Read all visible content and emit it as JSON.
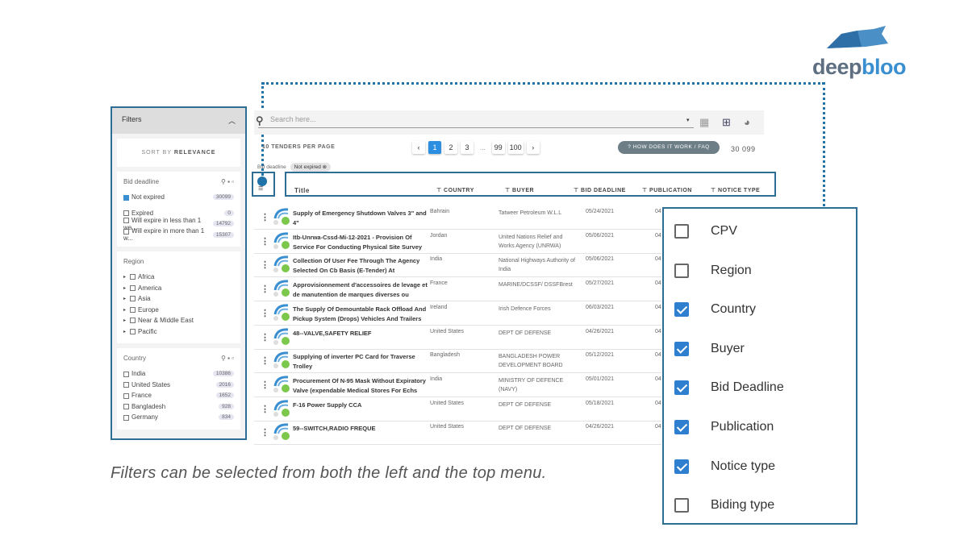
{
  "logo": {
    "text_a": "deep",
    "text_b": "bloo"
  },
  "filters": {
    "title": "Filters",
    "sort_prefix": "SORT BY",
    "sort_value": "RELEVANCE",
    "bid_deadline": {
      "title": "Bid deadline",
      "options": [
        {
          "label": "Not expired",
          "count": "30099",
          "checked": true
        },
        {
          "label": "Expired",
          "count": "0"
        },
        {
          "label": "Will expire in less than 1 we...",
          "count": "14792"
        },
        {
          "label": "Will expire in more than 1 w...",
          "count": "15307"
        }
      ]
    },
    "region": {
      "title": "Region",
      "options": [
        "Africa",
        "America",
        "Asia",
        "Europe",
        "Near & Middle East",
        "Pacific"
      ]
    },
    "country": {
      "title": "Country",
      "options": [
        {
          "label": "India",
          "count": "10386"
        },
        {
          "label": "United States",
          "count": "2016"
        },
        {
          "label": "France",
          "count": "1652"
        },
        {
          "label": "Bangladesh",
          "count": "928"
        },
        {
          "label": "Germany",
          "count": "834"
        }
      ]
    }
  },
  "search": {
    "placeholder": "Search here..."
  },
  "per_page": "10 TENDERS PER PAGE",
  "pages": [
    "1",
    "2",
    "3",
    "...",
    "99",
    "100"
  ],
  "faq": "HOW DOES IT WORK / FAQ",
  "total": "30 099",
  "chip": {
    "label": "Bid deadline",
    "value": "Not expired"
  },
  "columns": [
    "Title",
    "COUNTRY",
    "BUYER",
    "BID DEADLINE",
    "PUBLICATION",
    "NOTICE TYPE"
  ],
  "rows": [
    {
      "title": "Supply of Emergency Shutdown Valves 3\" and 4\"",
      "country": "Bahrain",
      "buyer": "Tatweer Petroleum W.L.L",
      "deadline": "05/24/2021",
      "pub": "04"
    },
    {
      "title": "Itb-Unrwa-Cssd-Mi-12-2021 - Provision Of Service For Conducting Physical Site Survey",
      "country": "Jordan",
      "buyer": "United Nations Relief and Works Agency (UNRWA)",
      "deadline": "05/06/2021",
      "pub": "04"
    },
    {
      "title": "Collection Of User Fee Through The Agency Selected On Cb Basis (E-Tender) At",
      "country": "India",
      "buyer": "National Highways Authority of India",
      "deadline": "05/06/2021",
      "pub": "04"
    },
    {
      "title": "Approvisionnement d'accessoires de levage et de manutention de marques diverses ou",
      "country": "France",
      "buyer": "MARINE/DCSSF/ DSSFBrest",
      "deadline": "05/27/2021",
      "pub": "04"
    },
    {
      "title": "The Supply Of Demountable Rack Offload And Pickup System (Drops) Vehicles And Trailers",
      "country": "Ireland",
      "buyer": "Irish Defence Forces",
      "deadline": "06/03/2021",
      "pub": "04"
    },
    {
      "title": "48--VALVE,SAFETY RELIEF",
      "country": "United States",
      "buyer": "DEPT OF DEFENSE",
      "deadline": "04/26/2021",
      "pub": "04"
    },
    {
      "title": "Supplying of inverter PC Card for Traverse Trolley",
      "country": "Bangladesh",
      "buyer": "BANGLADESH POWER DEVELOPMENT BOARD",
      "deadline": "05/12/2021",
      "pub": "04"
    },
    {
      "title": "Procurement Of N-95 Mask Without Expiratory Valve (expendable Medical Stores For Echs",
      "country": "India",
      "buyer": "MINISTRY OF DEFENCE (NAVY)",
      "deadline": "05/01/2021",
      "pub": "04"
    },
    {
      "title": "F-16 Power Supply CCA",
      "country": "United States",
      "buyer": "DEPT OF DEFENSE",
      "deadline": "05/18/2021",
      "pub": "04"
    },
    {
      "title": "59--SWITCH,RADIO FREQUE",
      "country": "United States",
      "buyer": "DEPT OF DEFENSE",
      "deadline": "04/26/2021",
      "pub": "04"
    }
  ],
  "column_menu": [
    {
      "label": "CPV",
      "checked": false
    },
    {
      "label": "Region",
      "checked": false
    },
    {
      "label": "Country",
      "checked": true
    },
    {
      "label": "Buyer",
      "checked": true
    },
    {
      "label": "Bid Deadline",
      "checked": true
    },
    {
      "label": "Publication",
      "checked": true
    },
    {
      "label": "Notice type",
      "checked": true
    },
    {
      "label": "Biding type",
      "checked": false
    }
  ],
  "caption": "Filters can be selected from both the left and the top menu."
}
